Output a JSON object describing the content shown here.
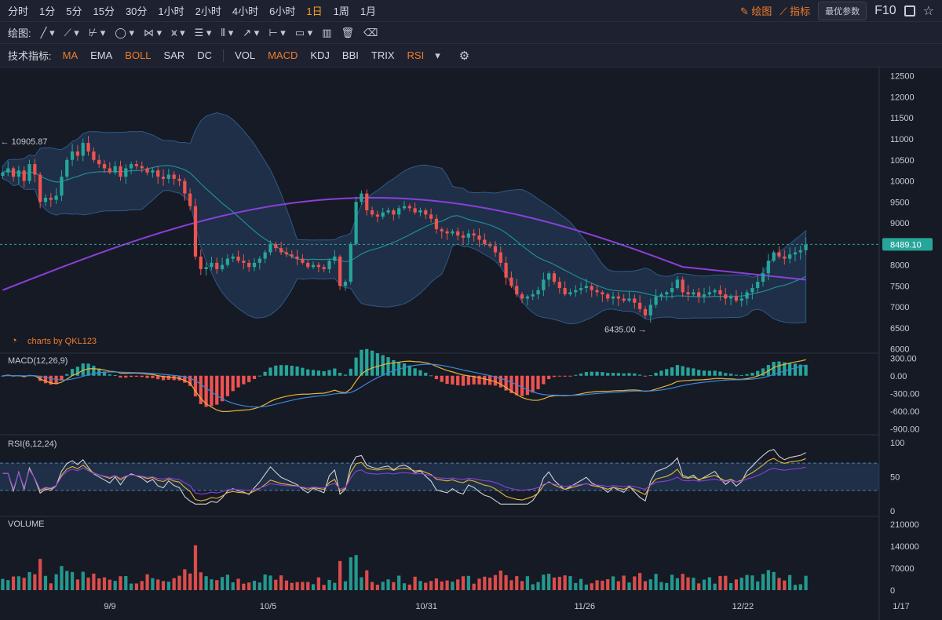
{
  "toolbar": {
    "timeframes": [
      "分时",
      "1分",
      "5分",
      "15分",
      "30分",
      "1小时",
      "2小时",
      "4小时",
      "6小时",
      "1日",
      "1周",
      "1月"
    ],
    "active_timeframe": "1日",
    "draw_label": "绘图",
    "indicator_label": "指标",
    "optimal_params": "最优参数",
    "f10": "F10"
  },
  "drawbar": {
    "label": "绘图:"
  },
  "indicators": {
    "label": "技术指标:",
    "main": [
      "MA",
      "EMA",
      "BOLL",
      "SAR",
      "DC"
    ],
    "sub": [
      "VOL",
      "MACD",
      "KDJ",
      "BBI",
      "TRIX",
      "RSI"
    ],
    "active": [
      "MA",
      "BOLL",
      "MACD",
      "RSI"
    ]
  },
  "watermark": "charts by QKL123",
  "colors": {
    "up": "#26a69a",
    "down": "#ef5350",
    "ma": "#8b3fd9",
    "boll_mid": "#1e8c96",
    "boll_band": "#2f5a86",
    "price_tag": "#26a69a"
  },
  "chart_data": {
    "type": "candlestick",
    "dates": [
      "9/9",
      "10/5",
      "10/31",
      "11/26",
      "12/22",
      "1/17"
    ],
    "price_axis": [
      12500,
      12000,
      11500,
      11000,
      10500,
      10000,
      9500,
      9000,
      8500,
      8000,
      7500,
      7000,
      6500,
      6000
    ],
    "price_ylim": [
      5900,
      12700
    ],
    "last_price": "8489.10",
    "last_price_value": 8489.1,
    "high_annotation": {
      "label": "10905.87",
      "value": 10905.87
    },
    "low_annotation": {
      "label": "6435.00",
      "value": 6435
    },
    "macd": {
      "title": "MACD(12,26,9)",
      "axis": [
        "300.00",
        "0.00",
        "-300.00",
        "-600.00",
        "-900.00"
      ],
      "ylim": [
        -950,
        330
      ]
    },
    "rsi": {
      "title": "RSI(6,12,24)",
      "axis": [
        "100",
        "50",
        "0"
      ],
      "bands": [
        70,
        30
      ]
    },
    "volume": {
      "title": "VOLUME",
      "axis": [
        "210000",
        "140000",
        "70000",
        "0"
      ],
      "ymax": 215000
    },
    "closes": [
      10200,
      10300,
      10100,
      10250,
      10000,
      10400,
      10150,
      9500,
      9600,
      9550,
      9650,
      10100,
      10500,
      10700,
      10600,
      10905,
      10700,
      10500,
      10400,
      10300,
      10200,
      10350,
      10100,
      10300,
      10400,
      10350,
      10300,
      10200,
      10250,
      10100,
      10050,
      10150,
      10050,
      10000,
      9700,
      9400,
      8200,
      7900,
      7950,
      8050,
      7900,
      8000,
      8150,
      8200,
      8100,
      8050,
      7950,
      8050,
      8150,
      8300,
      8500,
      8400,
      8300,
      8250,
      8200,
      8150,
      8050,
      7950,
      8000,
      7950,
      7900,
      8100,
      8200,
      7500,
      7600,
      8500,
      9500,
      9700,
      9300,
      9200,
      9150,
      9250,
      9300,
      9200,
      9350,
      9400,
      9350,
      9250,
      9300,
      9200,
      9100,
      8850,
      8800,
      8750,
      8800,
      8700,
      8650,
      8750,
      8700,
      8600,
      8500,
      8450,
      8300,
      8050,
      7700,
      7500,
      7300,
      7200,
      7250,
      7300,
      7400,
      7650,
      7800,
      7600,
      7450,
      7300,
      7350,
      7400,
      7450,
      7500,
      7400,
      7350,
      7300,
      7200,
      7250,
      7200,
      7150,
      7200,
      7100,
      6950,
      6800,
      7050,
      7250,
      7300,
      7350,
      7450,
      7650,
      7350,
      7300,
      7350,
      7250,
      7300,
      7350,
      7400,
      7300,
      7200,
      7250,
      7150,
      7200,
      7350,
      7450,
      7600,
      7800,
      8100,
      8300,
      8200,
      8150,
      8250,
      8300,
      8350,
      8489
    ]
  }
}
